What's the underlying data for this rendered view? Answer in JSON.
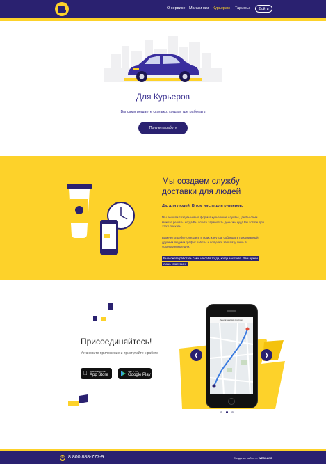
{
  "header": {
    "nav": [
      {
        "label": "О сервисе"
      },
      {
        "label": "Магазинам"
      },
      {
        "label": "Курьерам"
      },
      {
        "label": "Тарифы"
      }
    ],
    "login_label": "Войти"
  },
  "hero": {
    "title": "Для Курьеров",
    "subtitle": "Вы сами решаете сколько, когда и где работать",
    "cta_label": "Получить работу"
  },
  "about": {
    "title_line1": "Мы создаем службу",
    "title_line2": "доставки для людей",
    "bold": "Да, для людей. В том числе для курьеров.",
    "p1": "Мы решили создать новый формат курьерской службы, где Вы сами можете решать, когда Вы хотите заработать деньги и куда Вы хотите для этого поехать.",
    "p2": "Вам не потребуется ездить в офис к 9 утра, соблюдать придуманный другими людьми график работы и получать зарплату лишь в установленные дни.",
    "highlight": "Вы можете работать сами на себя тогда, когда захотите. Вам нужен лишь смартфон."
  },
  "join": {
    "title": "Присоединяйтесь!",
    "subtitle": "Установите приложение и приступайте к работе",
    "appstore_small": "Download on the",
    "appstore_big": "App Store",
    "gplay_small": "GET IT ON",
    "gplay_big": "Google Play",
    "phone_screen_text": "Ленинградский проспект"
  },
  "footer": {
    "phone": "8 800 888-777-9",
    "credit_prefix": "Создание сайта —",
    "credit_brand": "WEDLAND"
  },
  "colors": {
    "navy": "#2a2170",
    "yellow": "#fdd22a"
  },
  "icons": [
    "logo-courier-icon",
    "phone-icon",
    "apple-icon",
    "google-play-icon",
    "chevron-left-icon",
    "chevron-right-icon"
  ]
}
